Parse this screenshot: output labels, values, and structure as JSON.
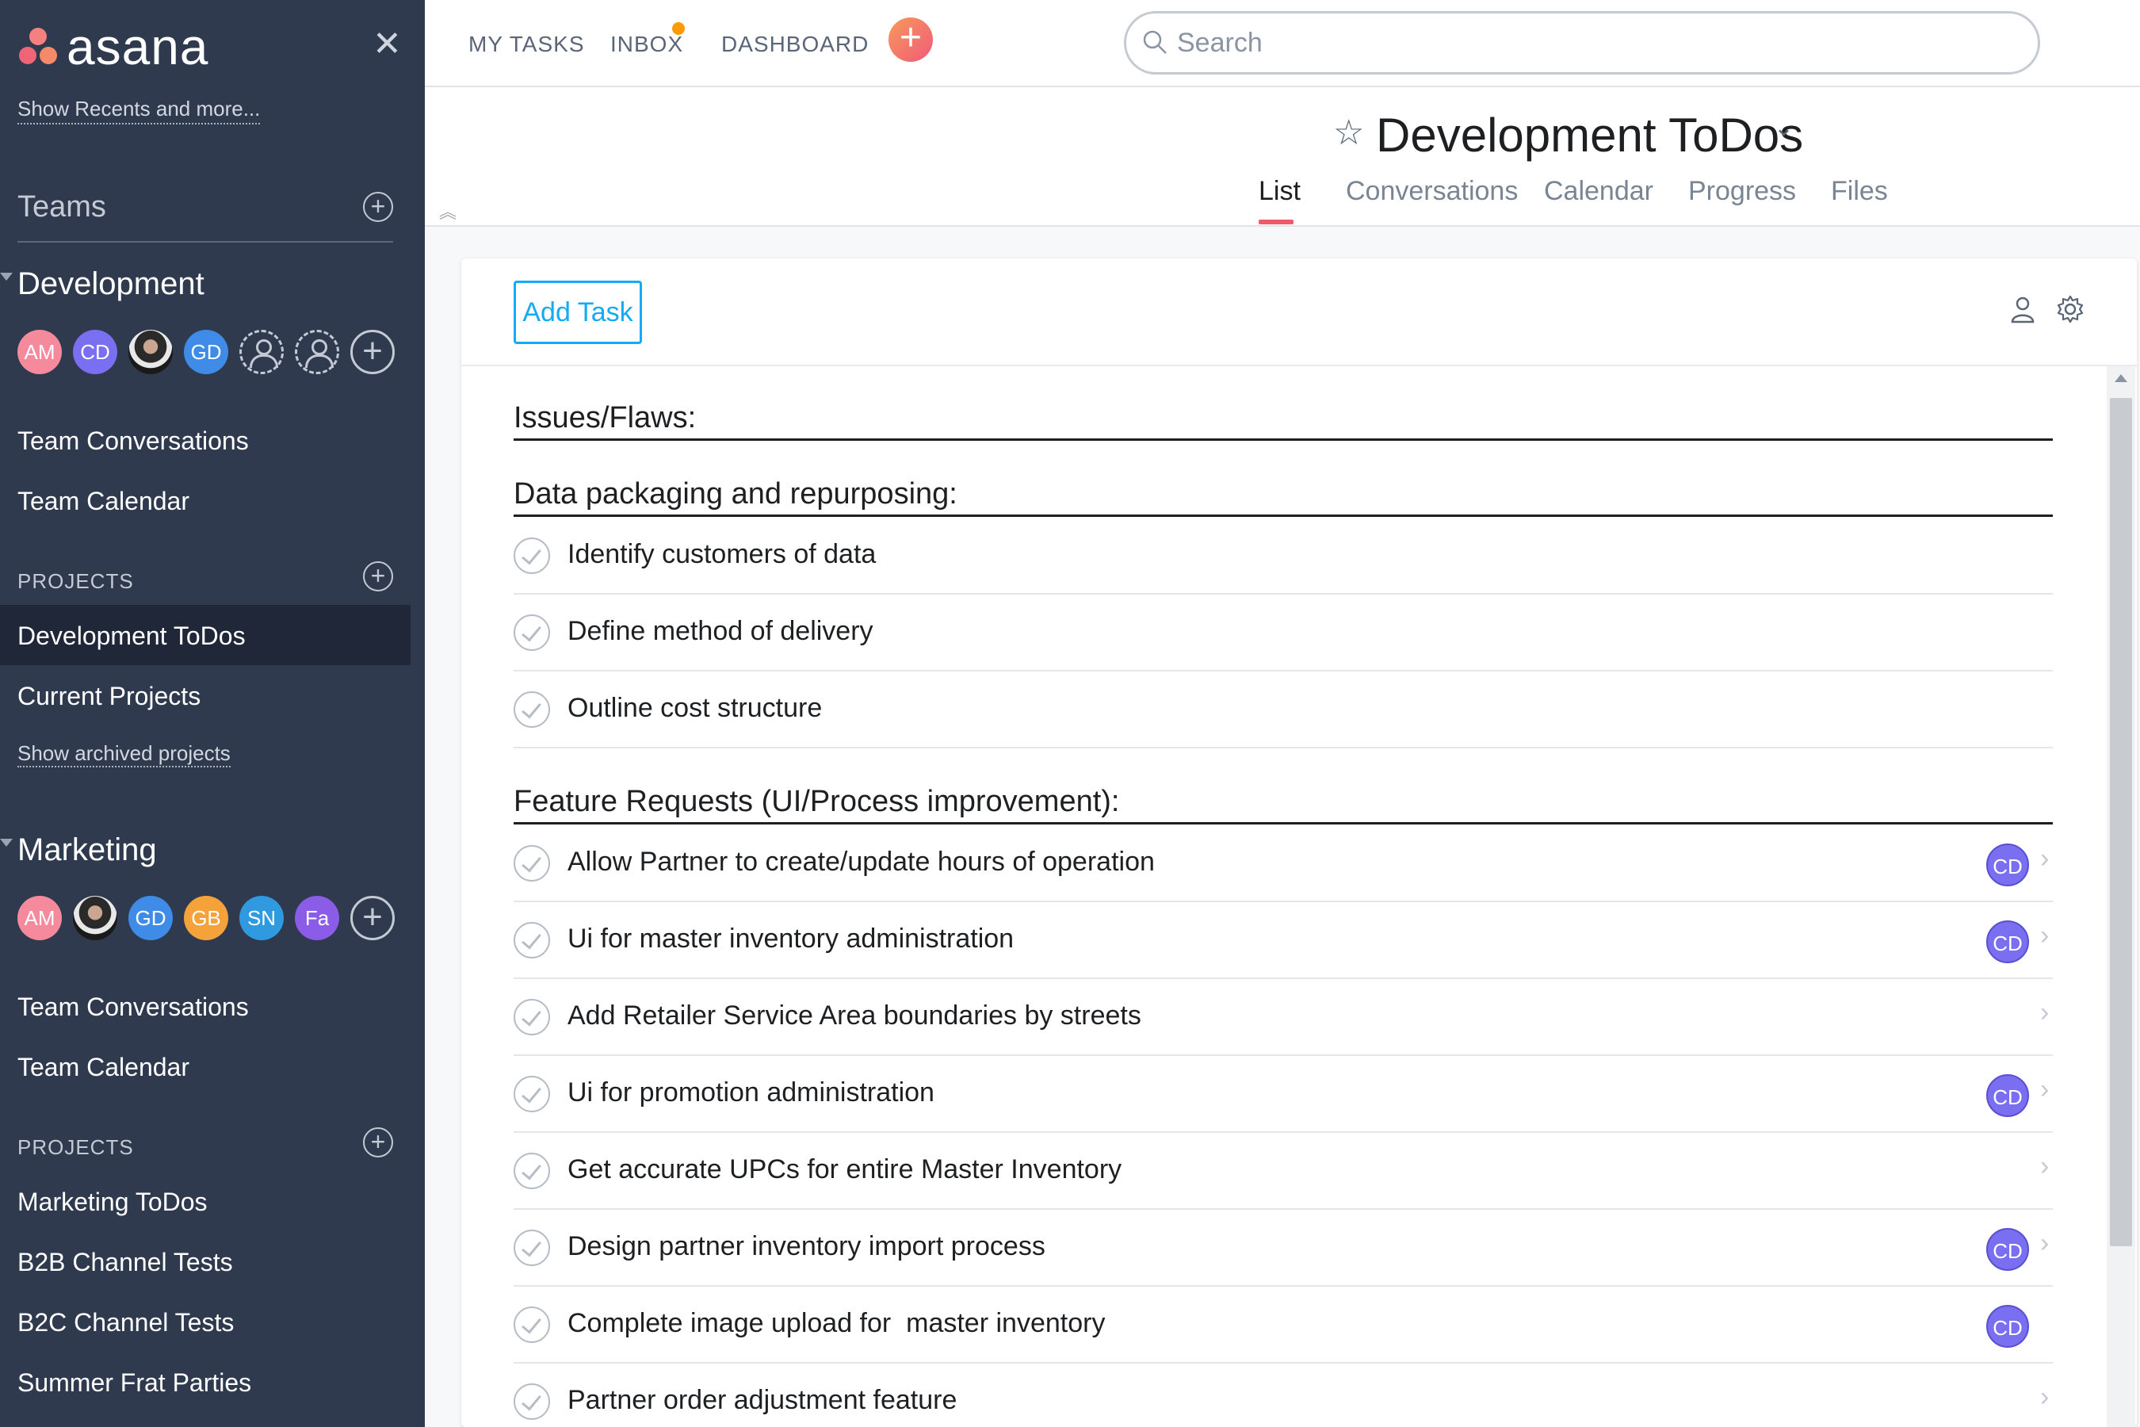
{
  "app": {
    "logo_text": "asana"
  },
  "sidebar": {
    "show_recents": "Show Recents and more...",
    "teams_label": "Teams",
    "teams": [
      {
        "name": "Development",
        "members": [
          "AM",
          "CD",
          "",
          "GD",
          "",
          ""
        ],
        "links": [
          "Team Conversations",
          "Team Calendar"
        ],
        "projects_label": "PROJECTS",
        "projects": [
          "Development ToDos",
          "Current Projects"
        ],
        "show_archived": "Show archived projects"
      },
      {
        "name": "Marketing",
        "members": [
          "AM",
          "",
          "GD",
          "GB",
          "SN",
          "Fa"
        ],
        "links": [
          "Team Conversations",
          "Team Calendar"
        ],
        "projects_label": "PROJECTS",
        "projects": [
          "Marketing ToDos",
          "B2B Channel Tests",
          "B2C Channel Tests",
          "Summer Frat Parties"
        ]
      }
    ],
    "selected_project": "Development ToDos"
  },
  "topbar": {
    "nav": [
      "MY TASKS",
      "INBOX",
      "DASHBOARD"
    ],
    "quick_add": "+",
    "search_placeholder": "Search"
  },
  "project": {
    "title": "Development ToDos",
    "tabs": [
      "List",
      "Conversations",
      "Calendar",
      "Progress",
      "Files"
    ],
    "active_tab": "List"
  },
  "toolbar": {
    "add_task_label": "Add Task"
  },
  "sections": [
    {
      "title": "Issues/Flaws:",
      "tasks": []
    },
    {
      "title": "Data packaging and repurposing:",
      "tasks": [
        {
          "name": "Identify customers of data",
          "assignee": ""
        },
        {
          "name": "Define method of delivery",
          "assignee": ""
        },
        {
          "name": "Outline cost structure",
          "assignee": ""
        }
      ]
    },
    {
      "title": "Feature Requests (UI/Process improvement):",
      "tasks": [
        {
          "name": "Allow Partner to create/update hours of operation",
          "assignee": "CD"
        },
        {
          "name": "Ui for master inventory administration",
          "assignee": "CD"
        },
        {
          "name": "Add Retailer Service Area boundaries by streets",
          "assignee": ""
        },
        {
          "name": "Ui for promotion administration",
          "assignee": "CD"
        },
        {
          "name": "Get accurate UPCs for entire Master Inventory",
          "assignee": ""
        },
        {
          "name": "Design partner inventory import process",
          "assignee": "CD"
        },
        {
          "name": "Complete image upload for  master inventory",
          "assignee": "CD"
        },
        {
          "name": "Partner order adjustment feature",
          "assignee": ""
        }
      ]
    }
  ],
  "colors": {
    "sidebar_bg": "#2f3a4f",
    "accent_blue": "#14aaf5",
    "tab_underline": "#f05a6a",
    "inbox_notification": "#fd9a00",
    "assignee_purple": "#7a6ff0"
  },
  "avatar_colors": {
    "AM": "#f58a9c",
    "CD": "#7a6ff0",
    "GD": "#3f8be8",
    "GB": "#f6a23a",
    "SN": "#2f9ae0",
    "Fa": "#8a5ce8"
  }
}
